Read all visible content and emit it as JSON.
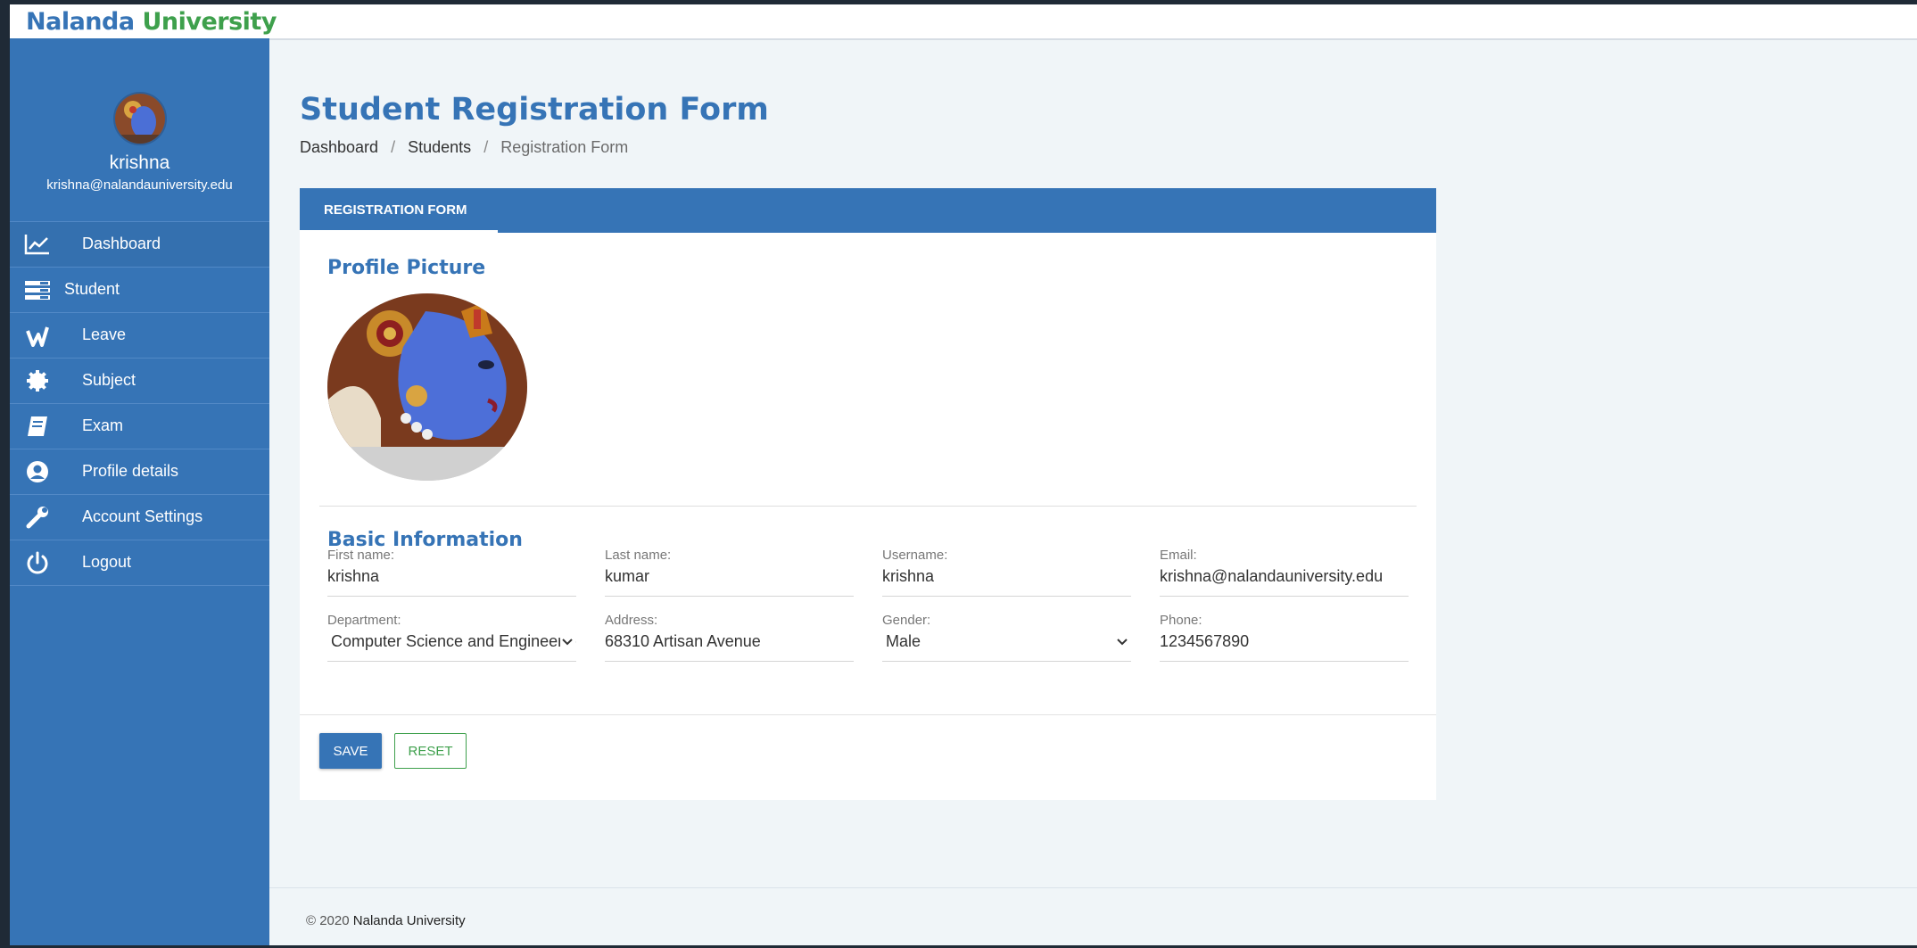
{
  "brand": {
    "part1": "Nalanda",
    "part2": "University"
  },
  "user": {
    "name": "krishna",
    "email": "krishna@nalandauniversity.edu"
  },
  "nav": [
    {
      "label": "Dashboard",
      "icon": "chart-line-icon"
    },
    {
      "label": "Student",
      "icon": "list-icon"
    },
    {
      "label": "Leave",
      "icon": "leave-icon"
    },
    {
      "label": "Subject",
      "icon": "gear-icon"
    },
    {
      "label": "Exam",
      "icon": "book-icon"
    },
    {
      "label": "Profile details",
      "icon": "user-circle-icon"
    },
    {
      "label": "Account Settings",
      "icon": "wrench-icon"
    },
    {
      "label": "Logout",
      "icon": "power-icon"
    }
  ],
  "page": {
    "title": "Student Registration Form"
  },
  "breadcrumb": {
    "items": [
      "Dashboard",
      "Students",
      "Registration Form"
    ],
    "separator": "/"
  },
  "form": {
    "tab": "REGISTRATION FORM",
    "profile_title": "Profile Picture",
    "basic_title": "Basic Information",
    "fields": {
      "first_name": {
        "label": "First name:",
        "value": "krishna"
      },
      "last_name": {
        "label": "Last name:",
        "value": "kumar"
      },
      "username": {
        "label": "Username:",
        "value": "krishna"
      },
      "email": {
        "label": "Email:",
        "value": "krishna@nalandauniversity.edu"
      },
      "department": {
        "label": "Department:",
        "value": "Computer Science and Engineering"
      },
      "address": {
        "label": "Address:",
        "value": "68310 Artisan Avenue"
      },
      "gender": {
        "label": "Gender:",
        "value": "Male"
      },
      "phone": {
        "label": "Phone:",
        "value": "1234567890"
      }
    },
    "save_label": "SAVE",
    "reset_label": "RESET"
  },
  "footer": {
    "copyright": "© 2020",
    "org": "Nalanda University"
  },
  "colors": {
    "primary": "#3674b6",
    "accent": "#3ea04c",
    "background": "#f0f5f8"
  }
}
